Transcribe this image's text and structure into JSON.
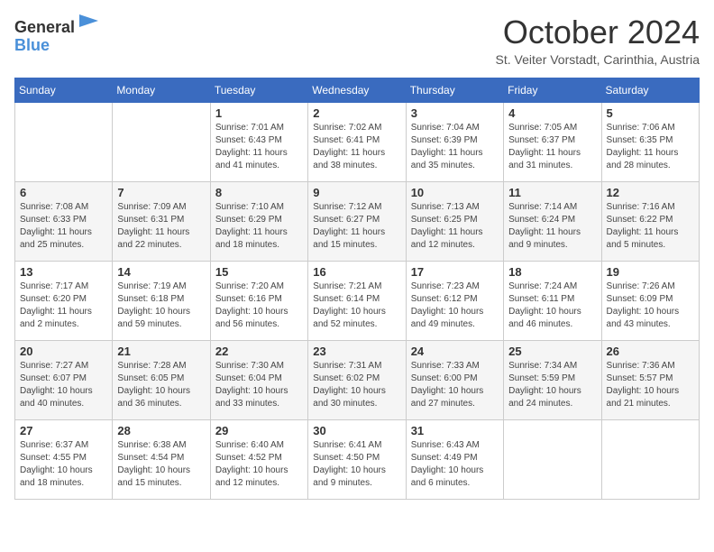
{
  "header": {
    "logo_general": "General",
    "logo_blue": "Blue",
    "month_title": "October 2024",
    "location": "St. Veiter Vorstadt, Carinthia, Austria"
  },
  "days_of_week": [
    "Sunday",
    "Monday",
    "Tuesday",
    "Wednesday",
    "Thursday",
    "Friday",
    "Saturday"
  ],
  "weeks": [
    [
      null,
      null,
      {
        "day": 1,
        "sunrise": "7:01 AM",
        "sunset": "6:43 PM",
        "daylight": "11 hours and 41 minutes."
      },
      {
        "day": 2,
        "sunrise": "7:02 AM",
        "sunset": "6:41 PM",
        "daylight": "11 hours and 38 minutes."
      },
      {
        "day": 3,
        "sunrise": "7:04 AM",
        "sunset": "6:39 PM",
        "daylight": "11 hours and 35 minutes."
      },
      {
        "day": 4,
        "sunrise": "7:05 AM",
        "sunset": "6:37 PM",
        "daylight": "11 hours and 31 minutes."
      },
      {
        "day": 5,
        "sunrise": "7:06 AM",
        "sunset": "6:35 PM",
        "daylight": "11 hours and 28 minutes."
      }
    ],
    [
      {
        "day": 6,
        "sunrise": "7:08 AM",
        "sunset": "6:33 PM",
        "daylight": "11 hours and 25 minutes."
      },
      {
        "day": 7,
        "sunrise": "7:09 AM",
        "sunset": "6:31 PM",
        "daylight": "11 hours and 22 minutes."
      },
      {
        "day": 8,
        "sunrise": "7:10 AM",
        "sunset": "6:29 PM",
        "daylight": "11 hours and 18 minutes."
      },
      {
        "day": 9,
        "sunrise": "7:12 AM",
        "sunset": "6:27 PM",
        "daylight": "11 hours and 15 minutes."
      },
      {
        "day": 10,
        "sunrise": "7:13 AM",
        "sunset": "6:25 PM",
        "daylight": "11 hours and 12 minutes."
      },
      {
        "day": 11,
        "sunrise": "7:14 AM",
        "sunset": "6:24 PM",
        "daylight": "11 hours and 9 minutes."
      },
      {
        "day": 12,
        "sunrise": "7:16 AM",
        "sunset": "6:22 PM",
        "daylight": "11 hours and 5 minutes."
      }
    ],
    [
      {
        "day": 13,
        "sunrise": "7:17 AM",
        "sunset": "6:20 PM",
        "daylight": "11 hours and 2 minutes."
      },
      {
        "day": 14,
        "sunrise": "7:19 AM",
        "sunset": "6:18 PM",
        "daylight": "10 hours and 59 minutes."
      },
      {
        "day": 15,
        "sunrise": "7:20 AM",
        "sunset": "6:16 PM",
        "daylight": "10 hours and 56 minutes."
      },
      {
        "day": 16,
        "sunrise": "7:21 AM",
        "sunset": "6:14 PM",
        "daylight": "10 hours and 52 minutes."
      },
      {
        "day": 17,
        "sunrise": "7:23 AM",
        "sunset": "6:12 PM",
        "daylight": "10 hours and 49 minutes."
      },
      {
        "day": 18,
        "sunrise": "7:24 AM",
        "sunset": "6:11 PM",
        "daylight": "10 hours and 46 minutes."
      },
      {
        "day": 19,
        "sunrise": "7:26 AM",
        "sunset": "6:09 PM",
        "daylight": "10 hours and 43 minutes."
      }
    ],
    [
      {
        "day": 20,
        "sunrise": "7:27 AM",
        "sunset": "6:07 PM",
        "daylight": "10 hours and 40 minutes."
      },
      {
        "day": 21,
        "sunrise": "7:28 AM",
        "sunset": "6:05 PM",
        "daylight": "10 hours and 36 minutes."
      },
      {
        "day": 22,
        "sunrise": "7:30 AM",
        "sunset": "6:04 PM",
        "daylight": "10 hours and 33 minutes."
      },
      {
        "day": 23,
        "sunrise": "7:31 AM",
        "sunset": "6:02 PM",
        "daylight": "10 hours and 30 minutes."
      },
      {
        "day": 24,
        "sunrise": "7:33 AM",
        "sunset": "6:00 PM",
        "daylight": "10 hours and 27 minutes."
      },
      {
        "day": 25,
        "sunrise": "7:34 AM",
        "sunset": "5:59 PM",
        "daylight": "10 hours and 24 minutes."
      },
      {
        "day": 26,
        "sunrise": "7:36 AM",
        "sunset": "5:57 PM",
        "daylight": "10 hours and 21 minutes."
      }
    ],
    [
      {
        "day": 27,
        "sunrise": "6:37 AM",
        "sunset": "4:55 PM",
        "daylight": "10 hours and 18 minutes."
      },
      {
        "day": 28,
        "sunrise": "6:38 AM",
        "sunset": "4:54 PM",
        "daylight": "10 hours and 15 minutes."
      },
      {
        "day": 29,
        "sunrise": "6:40 AM",
        "sunset": "4:52 PM",
        "daylight": "10 hours and 12 minutes."
      },
      {
        "day": 30,
        "sunrise": "6:41 AM",
        "sunset": "4:50 PM",
        "daylight": "10 hours and 9 minutes."
      },
      {
        "day": 31,
        "sunrise": "6:43 AM",
        "sunset": "4:49 PM",
        "daylight": "10 hours and 6 minutes."
      },
      null,
      null
    ]
  ]
}
